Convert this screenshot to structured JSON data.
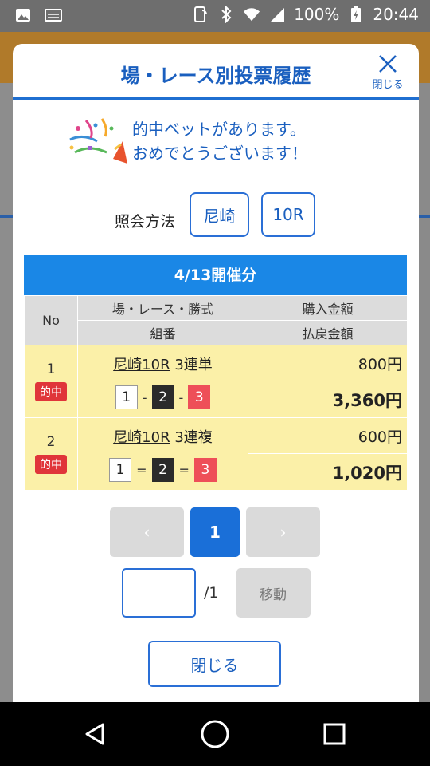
{
  "statusbar": {
    "battery_percent": "100%",
    "time": "20:44"
  },
  "modal": {
    "title": "場・レース別投票履歴",
    "close_label": "閉じる"
  },
  "congrats": {
    "line1": "的中ベットがあります。",
    "line2": "おめでとうございます！"
  },
  "lookup": {
    "label": "照会方法",
    "venue": "尼崎",
    "race": "10R"
  },
  "table": {
    "date_header": "4/13開催分",
    "col_no": "No",
    "col_race": "場・レース・勝式",
    "col_combo": "組番",
    "col_purchase": "購入金額",
    "col_payout": "払戻金額",
    "rows": [
      {
        "no": "1",
        "badge": "的中",
        "race": "尼崎10R",
        "bet_type": "3連単",
        "combo": [
          "1",
          "2",
          "3"
        ],
        "separator": "-",
        "purchase": "800円",
        "payout": "3,360円"
      },
      {
        "no": "2",
        "badge": "的中",
        "race": "尼崎10R",
        "bet_type": "3連複",
        "combo": [
          "1",
          "2",
          "3"
        ],
        "separator": "=",
        "purchase": "600円",
        "payout": "1,020円"
      }
    ]
  },
  "pager": {
    "prev": "‹",
    "current": "1",
    "next": "›"
  },
  "jump": {
    "value": "",
    "total": "/1",
    "button": "移動"
  },
  "footer": {
    "close_button": "閉じる"
  }
}
